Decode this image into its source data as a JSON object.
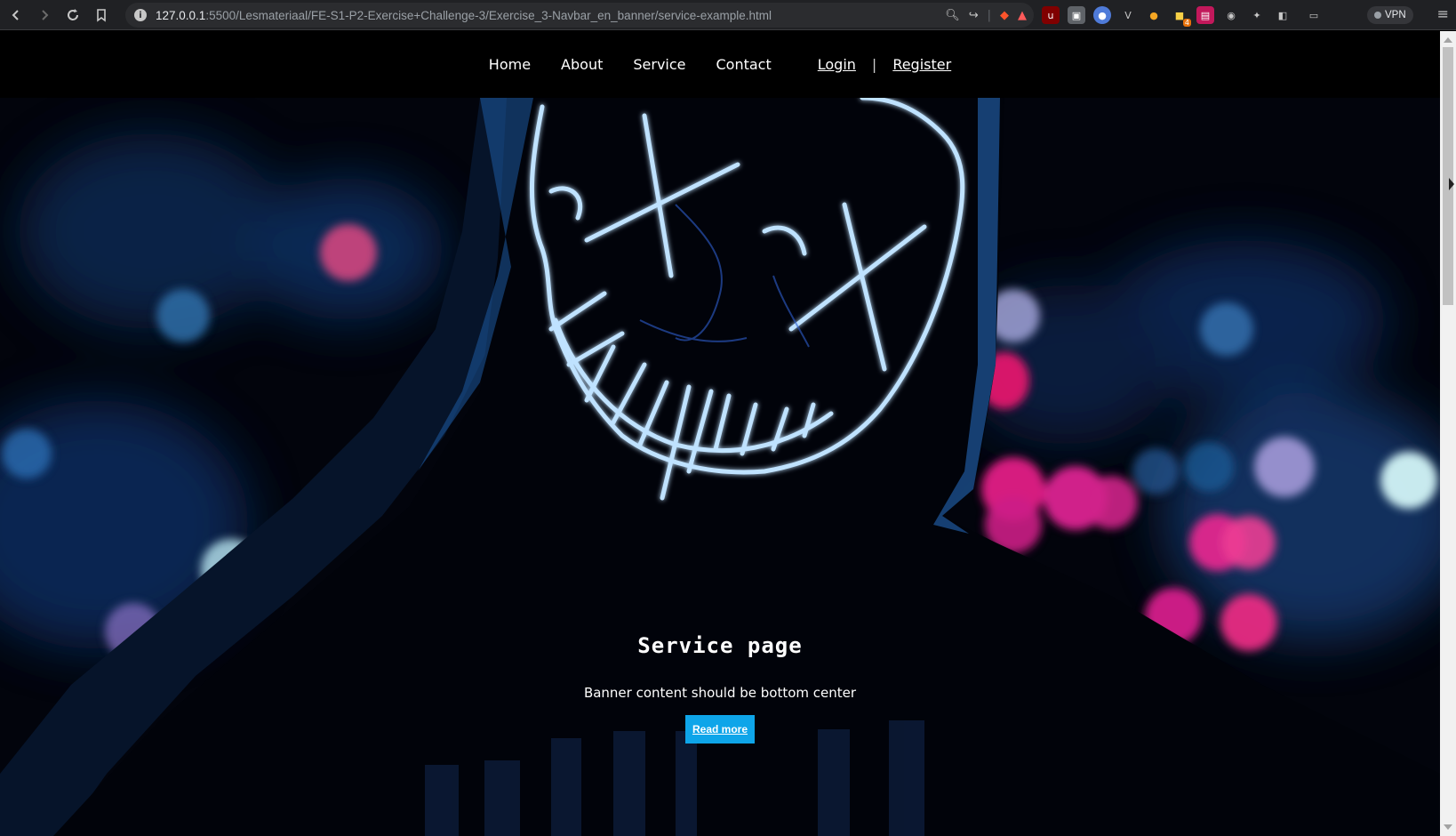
{
  "browser": {
    "url_host": "127.0.0.1",
    "url_path": ":5500/Lesmateriaal/FE-S1-P2-Exercise+Challenge-3/Exercise_3-Navbar_en_banner/service-example.html",
    "vpn_label": "VPN",
    "extension_badge": "4"
  },
  "navbar": {
    "links": [
      "Home",
      "About",
      "Service",
      "Contact"
    ],
    "login": "Login",
    "separator": "|",
    "register": "Register"
  },
  "banner": {
    "title": "Service page",
    "subtitle": "Banner content should be bottom center",
    "button": "Read more"
  },
  "colors": {
    "button": "#0ea5e9",
    "neon": "#7fc8ff",
    "bokeh_pink": "#e2207f",
    "bokeh_blue": "#1b5fa8"
  }
}
